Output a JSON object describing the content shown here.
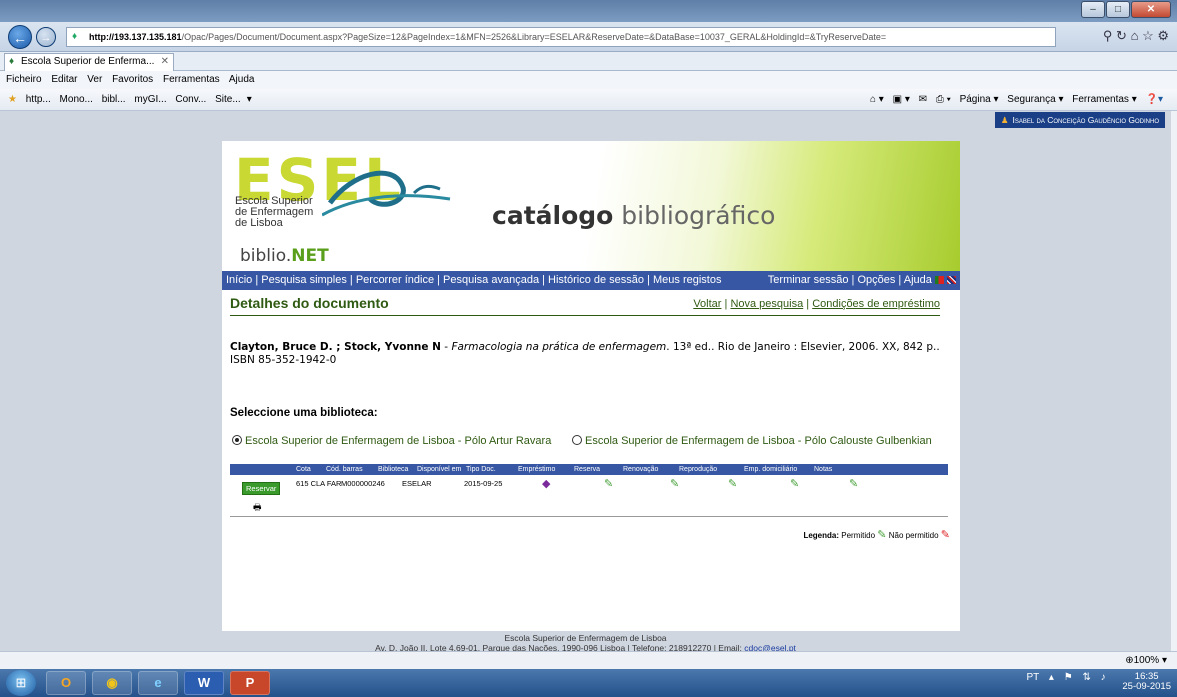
{
  "browser": {
    "url_host": "http://193.137.135.181",
    "url_rest": "/Opac/Pages/Document/Document.aspx?PageSize=12&PageIndex=1&MFN=2526&Library=ESELAR&ReserveDate=&DataBase=10037_GERAL&HoldingId=&TryReserveDate=",
    "tab_title": "Escola Superior de Enferma...",
    "menu": [
      "Ficheiro",
      "Editar",
      "Ver",
      "Favoritos",
      "Ferramentas",
      "Ajuda"
    ],
    "favorites": [
      "http...",
      "Mono...",
      "bibl...",
      "myGI...",
      "Conv...",
      "Site..."
    ],
    "commands": [
      "Página ▾",
      "Segurança ▾",
      "Ferramentas ▾"
    ],
    "zoom": "100%"
  },
  "user": "Isabel da Conceição Gaudêncio Godinho",
  "header": {
    "logo": "ESEL",
    "logo_sub": "Escola Superior de Enfermagem de Lisboa",
    "title_bold": "catálogo",
    "title_rest": "bibliográfico",
    "biblio_a": "biblio.",
    "biblio_b": "NET"
  },
  "nav": {
    "left": "Início | Pesquisa simples | Percorrer índice | Pesquisa avançada | Histórico de sessão | Meus registos",
    "right": "Terminar sessão | Opções | Ajuda"
  },
  "page_title": "Detalhes do documento",
  "links": [
    "Voltar",
    "Nova pesquisa",
    "Condições de empréstimo"
  ],
  "reference": {
    "authors": "Clayton, Bruce D. ; Stock, Yvonne N",
    "title": "Farmacologia na prática de enfermagem",
    "rest": "13ª ed.. Rio de Janeiro : Elsevier, 2006. XX, 842 p.. ISBN 85-352-1942-0"
  },
  "library_label": "Seleccione uma biblioteca:",
  "libraries": [
    {
      "name": "Escola Superior de Enfermagem de Lisboa - Pólo Artur Ravara",
      "selected": true
    },
    {
      "name": "Escola Superior de Enfermagem de Lisboa - Pólo Calouste Gulbenkian",
      "selected": false
    }
  ],
  "table": {
    "headers": [
      "Cota",
      "Cód. barras",
      "Biblioteca",
      "Disponível em",
      "Tipo Doc.",
      "Empréstimo",
      "Reserva",
      "Renovação",
      "Reprodução",
      "Emp. domiciliário",
      "Notas"
    ],
    "reserve_label": "Reservar",
    "row": {
      "cota": "615 CLA FAR",
      "barcode": "M000000246",
      "library": "ESELAR",
      "available": "2015-09-25"
    }
  },
  "legend": {
    "label": "Legenda:",
    "allowed": "Permitido",
    "not_allowed": "Não permitido"
  },
  "footer": {
    "line1": "Escola Superior de Enfermagem de Lisboa",
    "line2": "Av. D. João II, Lote 4.69-01, Parque das Nações, 1990-096 Lisboa | Telefone: 218912270 | Email:",
    "email": "cdoc@esel.pt"
  },
  "taskbar": {
    "lang": "PT",
    "time": "16:35",
    "date": "25-09-2015"
  },
  "colors": {
    "brand_blue": "#3757a4",
    "brand_green": "#2f5a12",
    "logo_lime": "#c9d832"
  }
}
